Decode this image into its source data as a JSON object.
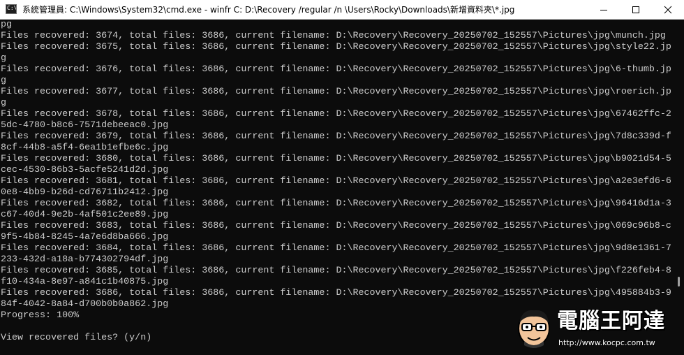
{
  "titlebar": {
    "icon_text": "C:\\",
    "title": "系統管理員: C:\\Windows\\System32\\cmd.exe - winfr  C: D:\\Recovery /regular /n \\Users\\Rocky\\Downloads\\新增資料夾\\*.jpg"
  },
  "console": {
    "lines": [
      "pg",
      "Files recovered: 3674, total files: 3686, current filename: D:\\Recovery\\Recovery_20250702_152557\\Pictures\\jpg\\munch.jpg",
      "Files recovered: 3675, total files: 3686, current filename: D:\\Recovery\\Recovery_20250702_152557\\Pictures\\jpg\\style22.jp",
      "g",
      "Files recovered: 3676, total files: 3686, current filename: D:\\Recovery\\Recovery_20250702_152557\\Pictures\\jpg\\6-thumb.jp",
      "g",
      "Files recovered: 3677, total files: 3686, current filename: D:\\Recovery\\Recovery_20250702_152557\\Pictures\\jpg\\roerich.jp",
      "g",
      "Files recovered: 3678, total files: 3686, current filename: D:\\Recovery\\Recovery_20250702_152557\\Pictures\\jpg\\67462ffc-2",
      "5dc-4780-b8c6-7571debeeac0.jpg",
      "Files recovered: 3679, total files: 3686, current filename: D:\\Recovery\\Recovery_20250702_152557\\Pictures\\jpg\\7d8c339d-f",
      "8cf-44b8-a5f4-6ea1b1efbe6c.jpg",
      "Files recovered: 3680, total files: 3686, current filename: D:\\Recovery\\Recovery_20250702_152557\\Pictures\\jpg\\b9021d54-5",
      "cec-4530-86b3-5acfe5241d2d.jpg",
      "Files recovered: 3681, total files: 3686, current filename: D:\\Recovery\\Recovery_20250702_152557\\Pictures\\jpg\\a2e3efd6-6",
      "0e8-4bb9-b26d-cd76711b2412.jpg",
      "Files recovered: 3682, total files: 3686, current filename: D:\\Recovery\\Recovery_20250702_152557\\Pictures\\jpg\\96416d1a-3",
      "c67-40d4-9e2b-4af501c2ee89.jpg",
      "Files recovered: 3683, total files: 3686, current filename: D:\\Recovery\\Recovery_20250702_152557\\Pictures\\jpg\\069c96b8-c",
      "9f5-4b84-8245-4a7e6d8ba666.jpg",
      "Files recovered: 3684, total files: 3686, current filename: D:\\Recovery\\Recovery_20250702_152557\\Pictures\\jpg\\9d8e1361-7",
      "233-432d-a18a-b774302794df.jpg",
      "Files recovered: 3685, total files: 3686, current filename: D:\\Recovery\\Recovery_20250702_152557\\Pictures\\jpg\\f226feb4-8",
      "f10-434a-8e97-a841c1b40875.jpg",
      "Files recovered: 3686, total files: 3686, current filename: D:\\Recovery\\Recovery_20250702_152557\\Pictures\\jpg\\495884b3-9",
      "84f-4042-8a84-d700b0b0a862.jpg",
      "Progress: 100%",
      "",
      "View recovered files? (y/n)"
    ]
  },
  "watermark": {
    "brand": "電腦王阿達",
    "url": "http://www.kocpc.com.tw"
  }
}
